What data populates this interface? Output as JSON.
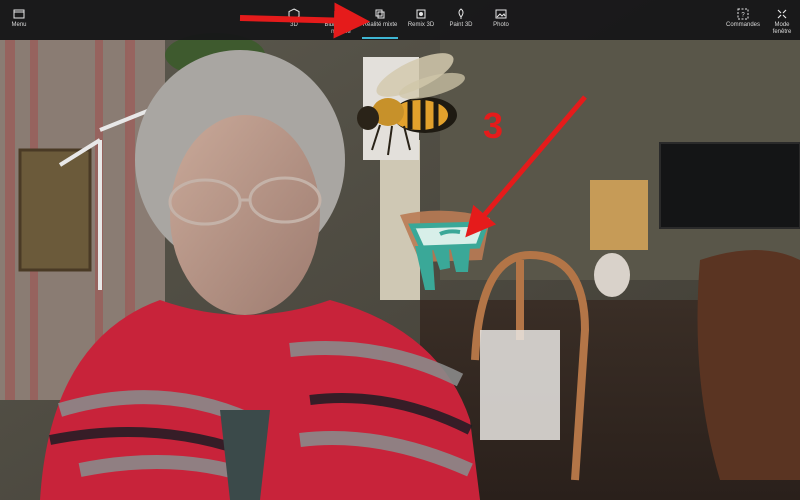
{
  "toolbar": {
    "menu_label": "Menu",
    "tools": [
      {
        "label": "3D",
        "icon": "box-icon"
      },
      {
        "label": "Bibliothèque\nmodèle",
        "icon": "library-icon"
      },
      {
        "label": "Réalité mixte",
        "icon": "mixed-reality-icon"
      },
      {
        "label": "Remix 3D",
        "icon": "remix-icon"
      },
      {
        "label": "Paint 3D",
        "icon": "paint-icon"
      },
      {
        "label": "Photo",
        "icon": "photo-icon"
      }
    ],
    "active_tool": "Réalité mixte",
    "commands_label": "Commandes",
    "window_mode_label": "Mode\nfenêtre",
    "accent_color": "#3fb6d3"
  },
  "annotation": {
    "number": "3",
    "color": "#e51b1b"
  },
  "scene": {
    "objects": [
      "bee-model",
      "toothbrush-holder-model",
      "tv",
      "lamp",
      "chair",
      "person"
    ]
  }
}
